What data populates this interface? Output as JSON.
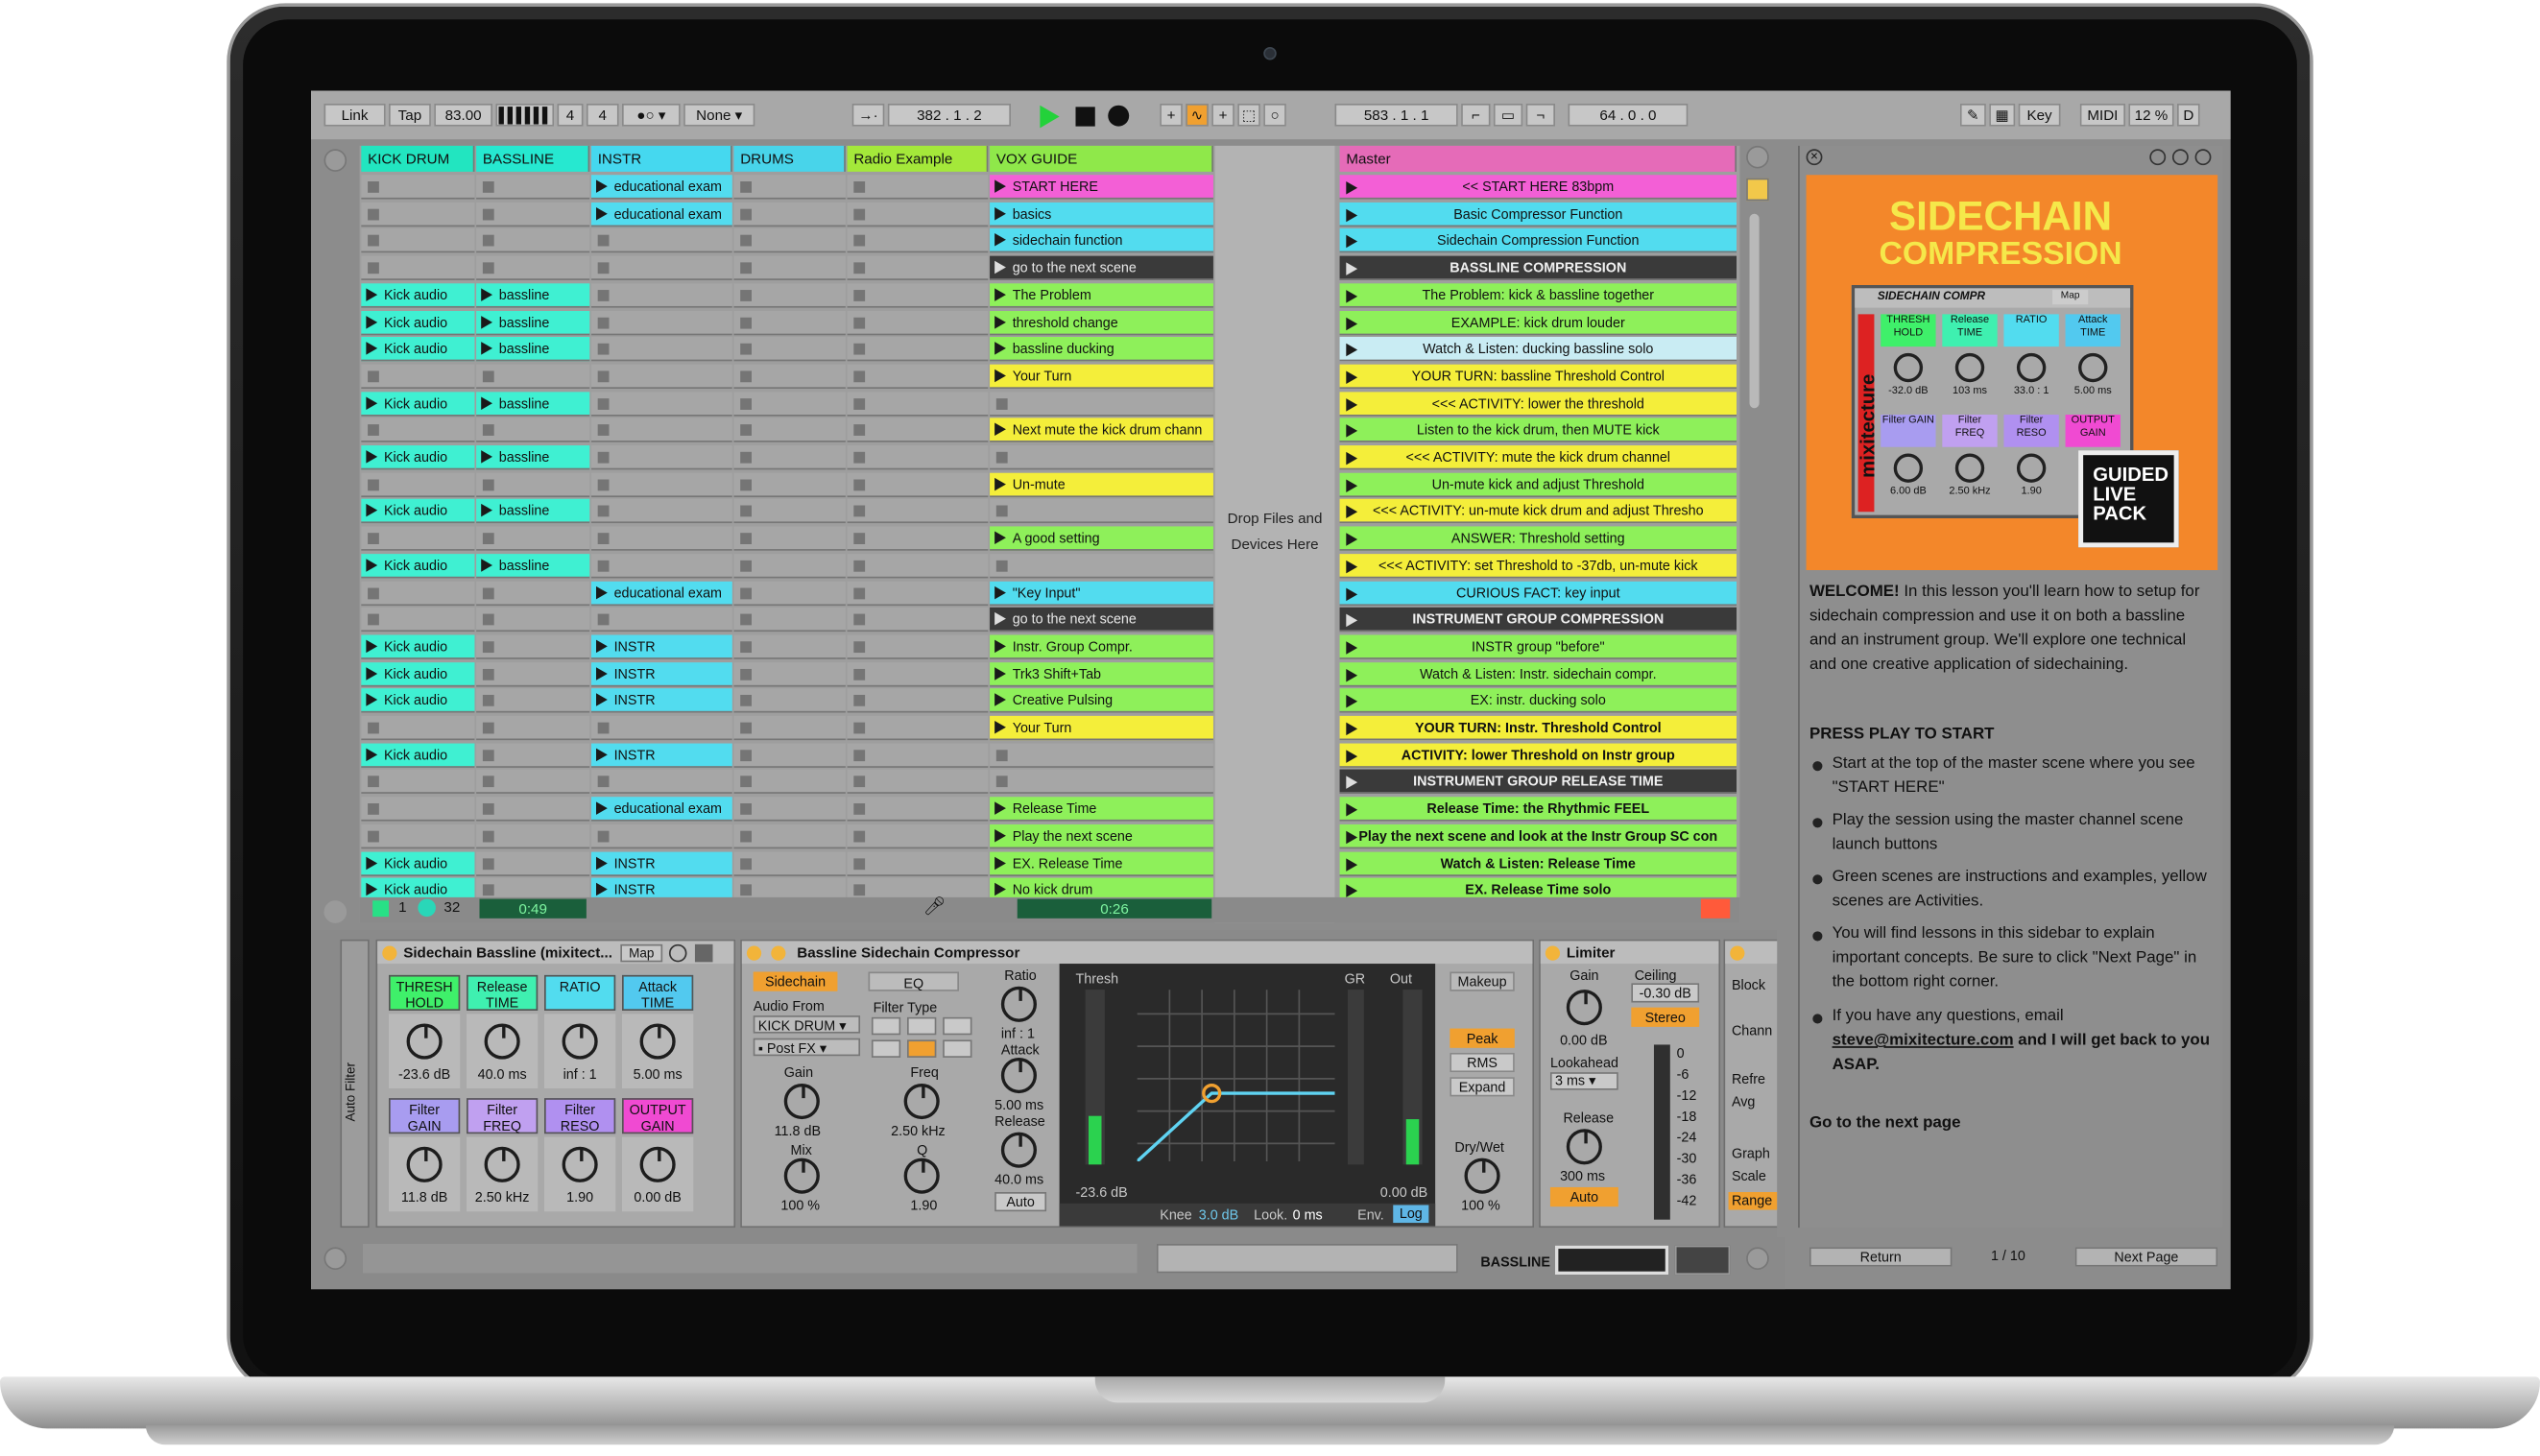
{
  "transport": {
    "link": "Link",
    "tap": "Tap",
    "tempo": "83.00",
    "meter_num": "4",
    "meter_den": "4",
    "quantize": "None",
    "position": "382 .  1 .  2",
    "loop_start": "583 .  1 .  1",
    "loop_len": "64 .  0 .  0",
    "key": "Key",
    "midi": "MIDI",
    "cpu": "12 %",
    "d": "D"
  },
  "tracks": [
    {
      "name": "KICK DRUM",
      "color": "#22e5c0"
    },
    {
      "name": "BASSLINE",
      "color": "#26e8d0"
    },
    {
      "name": "INSTR",
      "color": "#45d8ef"
    },
    {
      "name": "DRUMS",
      "color": "#48d4ea"
    },
    {
      "name": "Radio Example",
      "color": "#a4e83a"
    },
    {
      "name": "VOX GUIDE",
      "color": "#8fe84a"
    }
  ],
  "kick_clips": [
    "Kick audio",
    "Kick audio",
    "Kick audio",
    "Kick audio",
    "Kick audio",
    "Kick audio",
    "Kick audio",
    "Kick audio",
    "Kick audio",
    "Kick audio",
    "Kick audio",
    "Kick audio",
    "Kick audio"
  ],
  "bass_clips": [
    "bassline",
    "bassline",
    "bassline",
    "bassline",
    "bassline",
    "bassline",
    "bassline"
  ],
  "instr_clips": [
    "educational exam",
    "educational exam",
    "educational exam",
    "INSTR",
    "INSTR",
    "INSTR",
    "INSTR",
    "educational exam",
    "INSTR",
    "INSTR"
  ],
  "vox_clips": [
    "START HERE",
    "basics",
    "sidechain function",
    "go to the next scene",
    "The Problem",
    "threshold change",
    "bassline ducking",
    "Your Turn",
    "Next mute the kick drum chann",
    "Un-mute",
    "A good setting",
    "\"Key Input\"",
    "go to the next scene",
    "Instr. Group Compr.",
    "Trk3 Shift+Tab",
    "Creative Pulsing",
    "Your Turn",
    "Release Time",
    "Play the next scene",
    "EX. Release Time",
    "No kick drum"
  ],
  "drop_text": "Drop Files and Devices Here",
  "master_label": "Master",
  "scenes": [
    "<< START HERE  83bpm",
    "Basic Compressor Function",
    "Sidechain Compression Function",
    "BASSLINE COMPRESSION",
    "The Problem: kick & bassline together",
    "EXAMPLE: kick drum louder",
    "Watch & Listen: ducking bassline solo",
    "YOUR TURN: bassline Threshold Control",
    "<<< ACTIVITY: lower the threshold",
    "Listen to the kick drum, then MUTE kick",
    "<<< ACTIVITY: mute the kick drum channel",
    "Un-mute kick and adjust Threshold",
    "<<< ACTIVITY: un-mute kick drum and adjust Thresho",
    "ANSWER: Threshold setting",
    "<<< ACTIVITY: set Threshold to -37db, un-mute kick",
    "CURIOUS FACT: key input",
    "INSTRUMENT GROUP COMPRESSION",
    "INSTR group \"before\"",
    "Watch & Listen: Instr. sidechain compr.",
    "EX: instr. ducking solo",
    "YOUR TURN: Instr. Threshold Control",
    "ACTIVITY: lower Threshold on Instr group",
    "INSTRUMENT GROUP RELEASE TIME",
    "Release Time: the Rhythmic FEEL",
    "Play the next scene and look at the Instr Group SC con",
    "Watch & Listen: Release Time",
    "EX. Release Time solo"
  ],
  "status": {
    "one": "1",
    "thirtytwo": "32",
    "time1": "0:49",
    "time2": "0:26"
  },
  "rack": {
    "title": "Sidechain Bassline (mixitect...",
    "map": "Map",
    "labels": [
      "THRESH HOLD",
      "Release TIME",
      "RATIO",
      "Attack TIME",
      "Filter GAIN",
      "Filter FREQ",
      "Filter RESO",
      "OUTPUT GAIN"
    ],
    "values": [
      "-23.6 dB",
      "40.0 ms",
      "inf : 1",
      "5.00 ms",
      "11.8 dB",
      "2.50 kHz",
      "1.90",
      "0.00 dB"
    ]
  },
  "comp": {
    "title": "Bassline Sidechain Compressor",
    "sidechain": "Sidechain",
    "eq": "EQ",
    "audio_from": "Audio From",
    "source": "KICK DRUM",
    "post": "Post FX",
    "gain_l": "Gain",
    "gain_v": "11.8 dB",
    "mix_l": "Mix",
    "mix_v": "100 %",
    "filter_type": "Filter Type",
    "freq_l": "Freq",
    "freq_v": "2.50 kHz",
    "q_l": "Q",
    "q_v": "1.90",
    "ratio_l": "Ratio",
    "ratio_v": "inf : 1",
    "attack_l": "Attack",
    "attack_v": "5.00 ms",
    "release_l": "Release",
    "release_v": "40.0 ms",
    "auto": "Auto",
    "thresh": "Thresh",
    "gr": "GR",
    "out": "Out",
    "thresh_v": "-23.6 dB",
    "out_v": "0.00 dB",
    "knee": "Knee",
    "knee_v": "3.0 dB",
    "look": "Look.",
    "look_v": "0 ms",
    "env": "Env.",
    "log": "Log",
    "makeup": "Makeup",
    "peak": "Peak",
    "rms": "RMS",
    "expand": "Expand",
    "drywet": "Dry/Wet",
    "drywet_v": "100 %"
  },
  "limiter": {
    "title": "Limiter",
    "gain": "Gain",
    "gain_v": "0.00 dB",
    "ceiling": "Ceiling",
    "ceiling_v": "-0.30 dB",
    "stereo": "Stereo",
    "lookahead": "Lookahead",
    "look_v": "3 ms",
    "release": "Release",
    "release_v": "300 ms",
    "auto": "Auto",
    "scale": [
      "0",
      "-6",
      "-12",
      "-18",
      "-24",
      "-30",
      "-36",
      "-42"
    ]
  },
  "next_dev": {
    "block": "Block",
    "chann": "Chann",
    "refre": "Refre",
    "avg": "Avg",
    "graph": "Graph",
    "scale": "Scale",
    "range": "Range"
  },
  "auto_filter": "Auto Filter",
  "bottom": {
    "bassline": "BASSLINE"
  },
  "sidebar": {
    "banner1": "SIDECHAIN",
    "banner2": "COMPRESSION",
    "dev_title": "SIDECHAIN COMPR",
    "dev_map": "Map",
    "mini_labels": [
      "THRESH HOLD",
      "Release TIME",
      "RATIO",
      "Attack TIME",
      "Filter GAIN",
      "Filter FREQ",
      "Filter RESO",
      "OUTPUT GAIN"
    ],
    "mini_values": [
      "-32.0 dB",
      "103 ms",
      "33.0 : 1",
      "5.00 ms",
      "6.00 dB",
      "2.50 kHz",
      "1.90",
      ""
    ],
    "brand": "mixitecture",
    "guided1": "GUIDED",
    "guided2": "LIVE",
    "guided3": "PACK",
    "welcome": "WELCOME!",
    "intro": " In this lesson you'll learn how to setup for sidechain compression and use it on both a bassline and an instrument group.  We'll explore one technical and one creative application of sidechaining.",
    "press": "PRESS PLAY TO START",
    "b1": "Start at the top of the master scene where you see \"START HERE\"",
    "b2": "Play the session using the master channel scene launch buttons",
    "b3": "Green scenes are instructions and examples, yellow scenes are Activities.",
    "b4": "You will find lessons in this sidebar to explain important concepts. Be sure to click \"Next Page\" in the bottom right corner.",
    "b5a": "If you have any questions, email ",
    "email": "steve@mixitecture.com",
    "b5b": " and I will get back to you ASAP.",
    "goto": "Go to the next page",
    "return": "Return",
    "page": "1 / 10",
    "next": "Next Page"
  },
  "colors": {
    "green": "#8ef05a",
    "yellow": "#f4ee3a",
    "magenta": "#f35fd6",
    "cyan": "#52dcef",
    "lightblue": "#c9ecf3",
    "dark": "#3a3a3a",
    "kick": "#3ff0d2",
    "orange": "#f18a24"
  }
}
